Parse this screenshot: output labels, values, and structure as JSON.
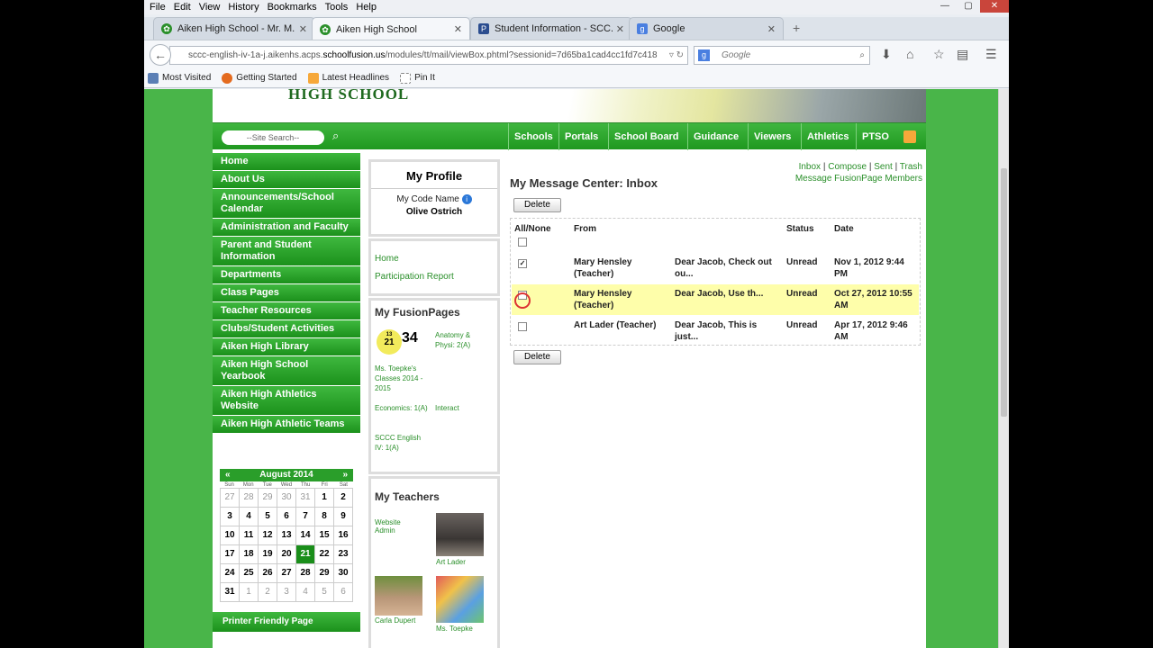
{
  "menubar": [
    "File",
    "Edit",
    "View",
    "History",
    "Bookmarks",
    "Tools",
    "Help"
  ],
  "tabs": [
    {
      "title": "Aiken High School - Mr. M..."
    },
    {
      "title": "Aiken High School"
    },
    {
      "title": "Student Information - SCC..."
    },
    {
      "title": "Google"
    }
  ],
  "address": {
    "prefix": "sccc-english-iv-1a-j.aikenhs.acps.",
    "domain": "schoolfusion.us",
    "rest": "/modules/tt/mail/viewBox.phtml?sessionid=7d65ba1cad4cc1fd7c418",
    "search_placeholder": "Google"
  },
  "bookmarks": [
    "Most Visited",
    "Getting Started",
    "Latest Headlines",
    "Pin It"
  ],
  "site": {
    "school_name": "HIGH SCHOOL",
    "search_placeholder": "--Site Search--",
    "topnav": [
      "Schools",
      "Portals",
      "School Board",
      "Guidance",
      "Viewers",
      "Athletics",
      "PTSO"
    ],
    "leftnav": [
      "Home",
      "About Us",
      "Announcements/School Calendar",
      "Administration and Faculty",
      "Parent and Student Information",
      "Departments",
      "Class Pages",
      "Teacher Resources",
      "Clubs/Student Activities",
      "Aiken High Library",
      "Aiken High School Yearbook",
      "Aiken High Athletics Website",
      "Aiken High Athletic Teams"
    ],
    "printer": "Printer Friendly Page"
  },
  "calendar": {
    "month": "August 2014",
    "prev": "«",
    "next": "»",
    "days": [
      "Sun",
      "Mon",
      "Tue",
      "Wed",
      "Thu",
      "Fri",
      "Sat"
    ],
    "cells": [
      "27",
      "28",
      "29",
      "30",
      "31",
      "1",
      "2",
      "3",
      "4",
      "5",
      "6",
      "7",
      "8",
      "9",
      "10",
      "11",
      "12",
      "13",
      "14",
      "15",
      "16",
      "17",
      "18",
      "19",
      "20",
      "21",
      "22",
      "23",
      "24",
      "25",
      "26",
      "27",
      "28",
      "29",
      "30",
      "31",
      "1",
      "2",
      "3",
      "4",
      "5",
      "6"
    ]
  },
  "profile": {
    "title": "My Profile",
    "code_label": "My Code Name",
    "code_name": "Olive Ostrich",
    "links": [
      "Home",
      "Participation Report"
    ]
  },
  "fusion": {
    "title": "My FusionPages",
    "badge_small": "13",
    "badge_mid": "21",
    "badge_big": "34",
    "pages": [
      "Ms. Toepke's Classes 2014 - 2015",
      "Anatomy & Physi: 2(A)",
      "Economics: 1(A)",
      "Interact",
      "SCCC English IV: 1(A)"
    ]
  },
  "teachers": {
    "title": "My Teachers",
    "list": [
      "Website Admin",
      "Art Lader",
      "Carla Dupert",
      "Ms. Toepke"
    ]
  },
  "mail": {
    "links": {
      "inbox": "Inbox",
      "compose": "Compose",
      "sent": "Sent",
      "trash": "Trash",
      "members": "Message FusionPage Members"
    },
    "title": "My Message Center: Inbox",
    "delete": "Delete",
    "headers": {
      "all": "All/None",
      "from": "From",
      "status": "Status",
      "date": "Date"
    },
    "rows": [
      {
        "from": "Mary Hensley (Teacher)",
        "subject": "Dear Jacob, Check out ou...",
        "status": "Unread",
        "date": "Nov 1, 2012 9:44 PM",
        "checked": "✓"
      },
      {
        "from": "Mary Hensley (Teacher)",
        "subject": "Dear Jacob,  Use th...",
        "status": "Unread",
        "date": "Oct 27, 2012 10:55 AM",
        "checked": ""
      },
      {
        "from": "Art Lader (Teacher)",
        "subject": "Dear Jacob, This is just...",
        "status": "Unread",
        "date": "Apr 17, 2012 9:46 AM",
        "checked": ""
      }
    ]
  }
}
